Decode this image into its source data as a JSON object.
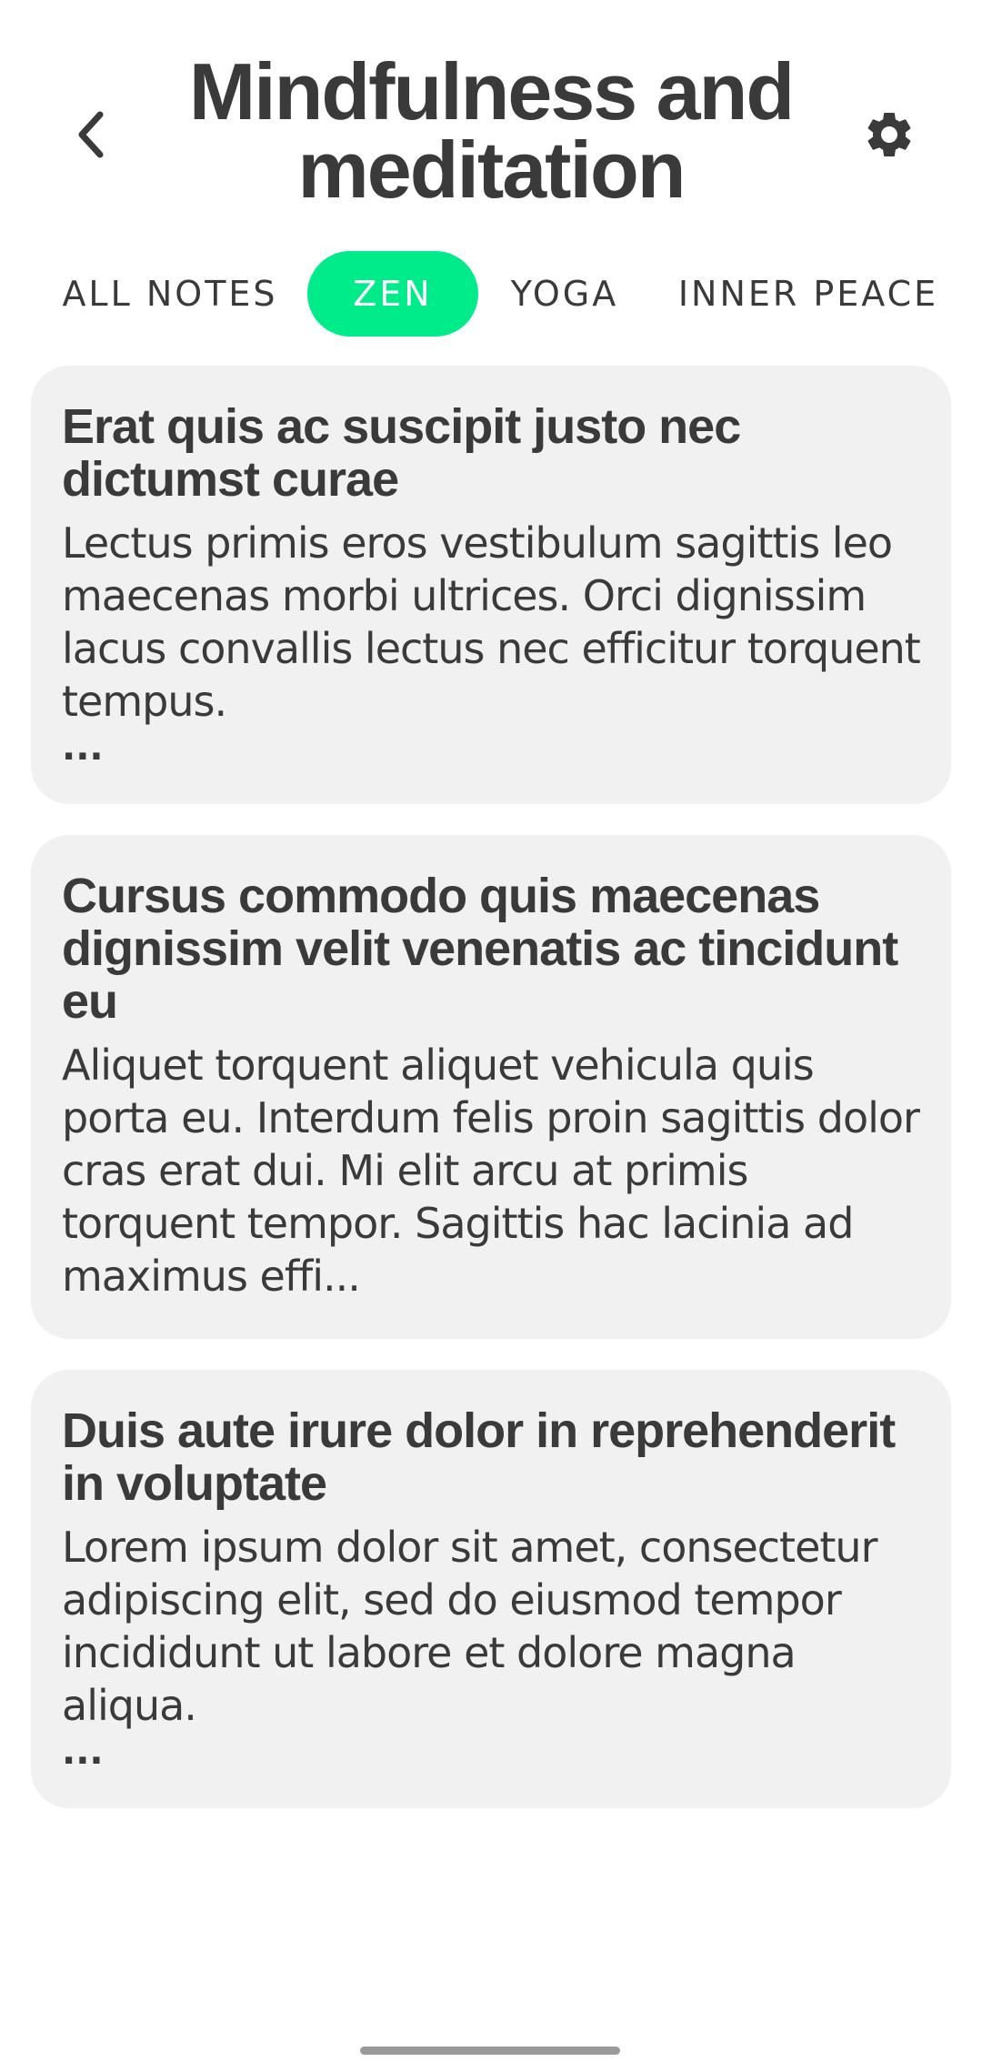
{
  "header": {
    "title": "Mindfulness and meditation",
    "back_icon": "chevron-left-icon",
    "settings_icon": "gear-icon"
  },
  "tabs": [
    {
      "label": "ALL NOTES",
      "active": false
    },
    {
      "label": "ZEN",
      "active": true
    },
    {
      "label": "YOGA",
      "active": false
    },
    {
      "label": "INNER PEACE",
      "active": false
    }
  ],
  "notes": [
    {
      "title": "Erat quis ac suscipit justo nec dictumst curae",
      "body": "Lectus primis eros vestibulum sagittis leo maecenas morbi ultrices. Orci dignissim lacus convallis lectus nec efficitur torquent tempus.",
      "more": "..."
    },
    {
      "title": "Cursus commodo quis maecenas dignissim velit venenatis ac tincidunt eu",
      "body": "Aliquet torquent aliquet vehicula quis porta eu. Interdum felis proin sagittis dolor cras erat dui. Mi elit arcu at primis torquent tempor. Sagittis hac lacinia ad maximus effi...",
      "more": ""
    },
    {
      "title": "Duis aute irure dolor in reprehenderit in voluptate",
      "body": "Lorem ipsum dolor sit amet, consectetur adipiscing elit, sed do eiusmod tempor incididunt ut labore et dolore magna aliqua.",
      "more": "..."
    }
  ],
  "colors": {
    "accent": "#00ec8a",
    "text": "#3a3a3a",
    "card": "#f1f1f1"
  }
}
